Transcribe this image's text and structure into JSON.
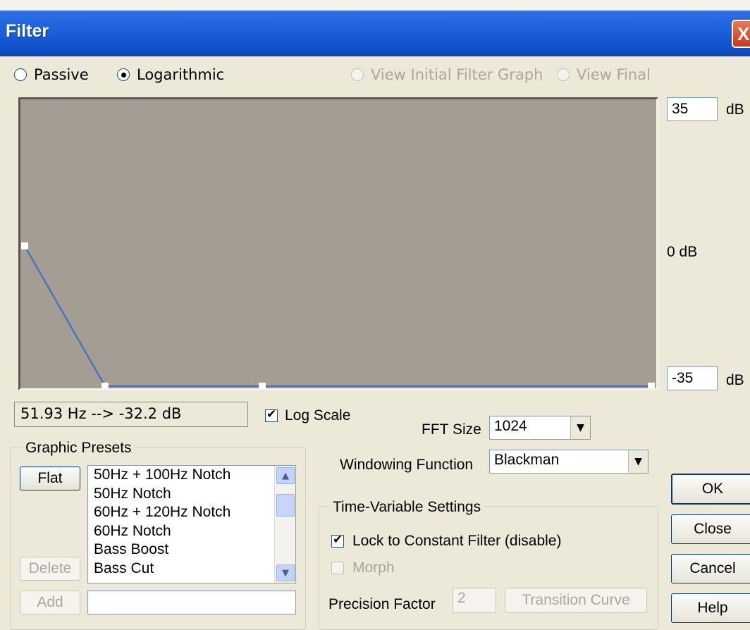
{
  "window": {
    "title": "Filter",
    "close_glyph": "X"
  },
  "mode": {
    "passive_label": "Passive",
    "logarithmic_label": "Logarithmic",
    "selected": "Logarithmic",
    "view_initial_label": "View Initial Filter Graph",
    "view_final_label": "View Final"
  },
  "graph": {
    "top_db_value": "35",
    "top_db_unit": "dB",
    "mid_label": "0 dB",
    "bottom_db_value": "-35",
    "bottom_db_unit": "dB",
    "readout": "51.93 Hz --> -32.2 dB",
    "curve_color": "#4a74c2",
    "background_color": "#a39d93"
  },
  "log_scale": {
    "label": "Log Scale",
    "checked": true
  },
  "fft": {
    "label": "FFT Size",
    "value": "1024"
  },
  "windowing": {
    "label": "Windowing Function",
    "value": "Blackman"
  },
  "presets": {
    "group_label": "Graphic Presets",
    "flat_label": "Flat",
    "delete_label": "Delete",
    "add_label": "Add",
    "add_input_value": "",
    "items": [
      "50Hz + 100Hz Notch",
      "50Hz Notch",
      "60Hz + 120Hz Notch",
      "60Hz Notch",
      "Bass Boost",
      "Bass Cut"
    ],
    "scroll_up_icon": "chevron-up-icon",
    "scroll_down_icon": "chevron-down-icon"
  },
  "time_variable": {
    "group_label": "Time-Variable Settings",
    "lock_label": "Lock to Constant Filter (disable)",
    "lock_checked": true,
    "morph_label": "Morph",
    "precision_label": "Precision Factor",
    "precision_value": "2",
    "transition_label": "Transition Curve"
  },
  "buttons": {
    "ok": "OK",
    "close": "Close",
    "cancel": "Cancel",
    "help": "Help"
  }
}
